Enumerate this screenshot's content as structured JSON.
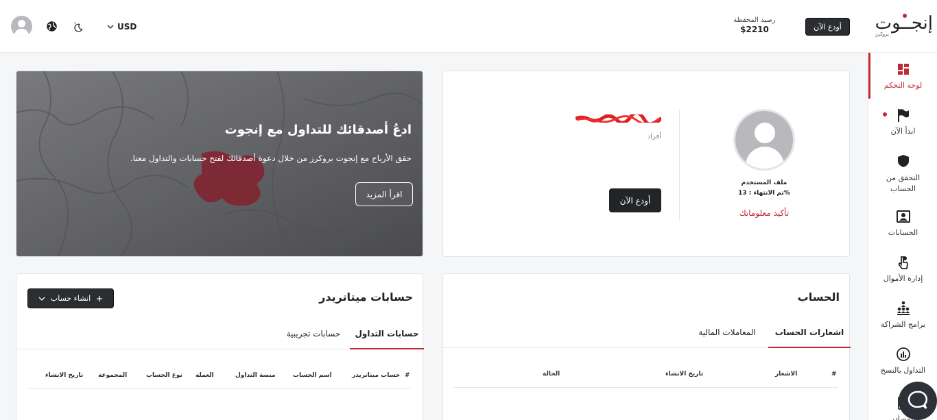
{
  "header": {
    "currency": "USD",
    "balance_label": "رصيد المحفظة",
    "balance_value": "$2210",
    "deposit_label": "أودع الآن",
    "logo_text": "إنجــوت",
    "logo_sub": "بروكرز"
  },
  "sidebar": {
    "items": [
      {
        "label": "لوحة التحكم",
        "icon": "dashboard-icon"
      },
      {
        "label": "ابدأ الآن",
        "icon": "flag-icon"
      },
      {
        "label": "التحقق من الحساب",
        "icon": "shield-icon"
      },
      {
        "label": "الحسابات",
        "icon": "accounts-icon"
      },
      {
        "label": "إدارة الأموال",
        "icon": "funds-icon"
      },
      {
        "label": "برامج الشراكة",
        "icon": "partnership-icon"
      },
      {
        "label": "التداول بالنسخ",
        "icon": "copy-trading-icon"
      },
      {
        "label": "المصادر",
        "icon": "resources-icon"
      }
    ],
    "accent": "#c02a34"
  },
  "profile": {
    "title": "ملف المستخدم",
    "completion": "تم الانتهاء : 13%",
    "confirm_link": "تأكيد معلوماتك",
    "account_type": "أفراد",
    "deposit_label": "أودع الآن"
  },
  "promo": {
    "title": "ادعُ أصدقائك للتداول مع إنجوت",
    "description": "حقق الأرباح مع إنجوت بروكرز من خلال دعوة أصدقائك لفتح حسابات والتداول معنا.",
    "button": "اقرأ المزيد"
  },
  "account": {
    "title": "الحساب",
    "tabs": [
      "اشعارات الحساب",
      "المعاملات المالية"
    ],
    "columns": [
      "#",
      "الاشعار",
      "تاريخ الانشاء",
      "الحالة"
    ]
  },
  "metatrader": {
    "title": "حسابات ميتاتريدر",
    "create_button": "انشاء حساب",
    "tabs": [
      "حسابات التداول",
      "حسابات تجريبية"
    ],
    "columns": [
      "#",
      "حساب ميتاتريدر",
      "اسم الحساب",
      "منصة التداول",
      "العملة",
      "نوع الحساب",
      "المجموعة",
      "تاريخ الانشاء"
    ]
  }
}
